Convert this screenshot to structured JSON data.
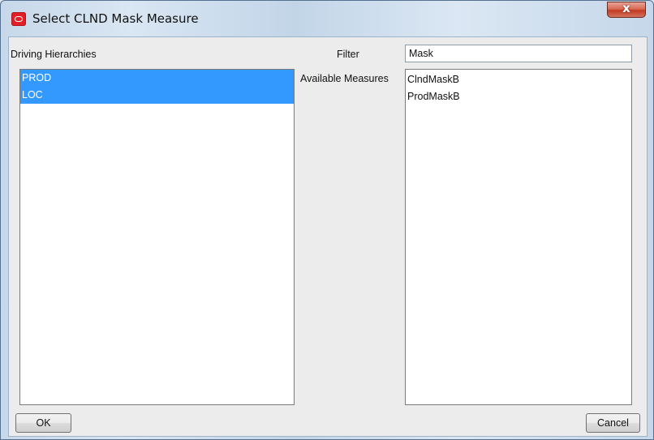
{
  "window": {
    "title": "Select CLND Mask Measure",
    "close_label": "x"
  },
  "dialog": {
    "driving_hierarchies_label": "Driving Hierarchies",
    "driving_hierarchies": [
      {
        "label": "PROD",
        "selected": true
      },
      {
        "label": "LOC",
        "selected": true
      }
    ],
    "filter_label": "Filter",
    "filter_value": "Mask",
    "available_measures_label": "Available Measures",
    "available_measures": [
      {
        "label": "ClndMaskB",
        "selected": false
      },
      {
        "label": "ProdMaskB",
        "selected": false
      }
    ],
    "ok_label": "OK",
    "cancel_label": "Cancel"
  },
  "colors": {
    "selection": "#3399ff",
    "close_button": "#c23a22"
  },
  "icons": {
    "app": "oracle-icon",
    "close": "close-icon"
  }
}
